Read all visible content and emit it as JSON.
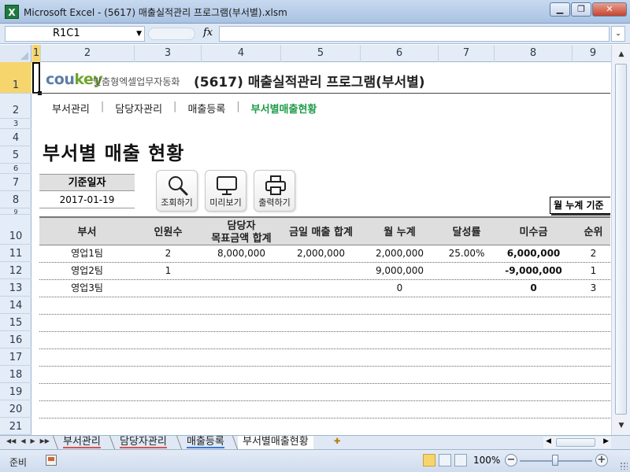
{
  "window": {
    "title": "Microsoft Excel - (5617) 매출실적관리 프로그램(부서별).xlsm",
    "app_icon": "X"
  },
  "formula_bar": {
    "name_box": "R1C1",
    "fx_label": "fx",
    "formula": ""
  },
  "columns": [
    "1",
    "2",
    "3",
    "4",
    "5",
    "6",
    "7",
    "8",
    "9"
  ],
  "rows": [
    "1",
    "2",
    "3",
    "4",
    "5",
    "6",
    "7",
    "8",
    "9",
    "10",
    "11",
    "12",
    "13",
    "14",
    "15",
    "16",
    "17",
    "18",
    "19",
    "20",
    "21"
  ],
  "brand": {
    "logo_main": "cou",
    "logo_key": "key",
    "tagline": "맞춤형엑셀업무자동화",
    "app_title": "(5617) 매출실적관리 프로그램(부서별)"
  },
  "nav": {
    "items": [
      "부서관리",
      "담당자관리",
      "매출등록",
      "부서별매출현황"
    ],
    "separator": "|",
    "active_index": 3
  },
  "page_heading": "부서별 매출 현황",
  "base_date": {
    "label": "기준일자",
    "value": "2017-01-19"
  },
  "toolbar": {
    "search_label": "조회하기",
    "preview_label": "미리보기",
    "print_label": "출력하기"
  },
  "month_tag": "월 누계 기준",
  "table": {
    "headers": {
      "dept": "부서",
      "staff": "인원수",
      "target_line1": "담당자",
      "target_line2": "목표금액 합계",
      "today": "금일 매출 합계",
      "monthly": "월 누계",
      "rate": "달성률",
      "unpaid": "미수금",
      "rank": "순위"
    },
    "rows": [
      {
        "dept": "영업1팀",
        "staff": "2",
        "target": "8,000,000",
        "today": "2,000,000",
        "monthly": "2,000,000",
        "rate": "25.00%",
        "unpaid": "6,000,000",
        "rank": "2"
      },
      {
        "dept": "영업2팀",
        "staff": "1",
        "target": "",
        "today": "",
        "monthly": "9,000,000",
        "rate": "",
        "unpaid": "-9,000,000",
        "rank": "1"
      },
      {
        "dept": "영업3팀",
        "staff": "",
        "target": "",
        "today": "",
        "monthly": "0",
        "rate": "",
        "unpaid": "0",
        "rank": "3"
      }
    ]
  },
  "sheet_tabs": [
    {
      "label": "부서관리",
      "color": "#d9534f",
      "active": false
    },
    {
      "label": "담당자관리",
      "color": "#d9534f",
      "active": false
    },
    {
      "label": "매출등록",
      "color": "#3a7bd5",
      "active": false
    },
    {
      "label": "부서별매출현황",
      "color": "#ffffff",
      "active": true
    }
  ],
  "status": {
    "ready": "준비",
    "zoom": "100%"
  },
  "colors": {
    "accent_green": "#1f9c4a",
    "logo_blue": "#5a7da6",
    "logo_green": "#6fa530"
  }
}
